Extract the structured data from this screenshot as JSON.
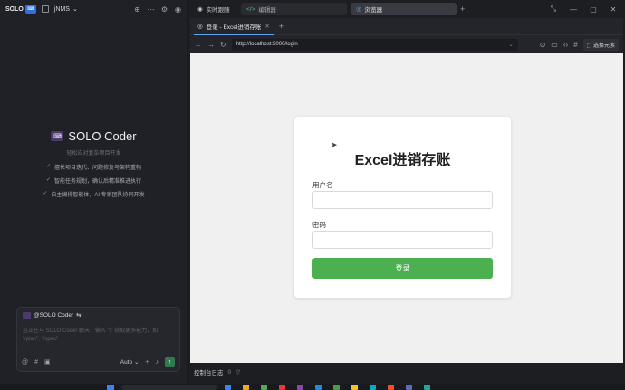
{
  "left": {
    "logo": "SOLO",
    "logo_badge": "⌨",
    "project": "jNMS",
    "hero_title": "SOLO Coder",
    "hero_subtitle": "轻松应对复杂项目开发",
    "features": [
      "擅长项目迭代、问题修复与架构重构",
      "智能任务规划，确认后精准推进执行",
      "自主编排智能体，AI 专家团队协同开发"
    ],
    "composer_tag": "@SOLO Coder",
    "composer_placeholder": "这正在与 SOLO Coder 聊天，输入 \"/\" 获取更多能力，如 \"/plan\", \"/spec\"",
    "mode": "Auto"
  },
  "tabs": {
    "realtime": "实时跟随",
    "editor": "编辑器",
    "browser": "浏览器"
  },
  "browser": {
    "tab_title": "登录 - Excel进销存账",
    "url": "http://localhost:5000/login",
    "pick_element": "选择元素"
  },
  "page": {
    "title": "Excel进销存账",
    "username_label": "用户名",
    "password_label": "密码",
    "login_button": "登录"
  },
  "console": {
    "label": "控制台日志",
    "count": "0"
  },
  "colors": {
    "login_green": "#4caf50",
    "accent_blue": "#5ea3f0"
  }
}
